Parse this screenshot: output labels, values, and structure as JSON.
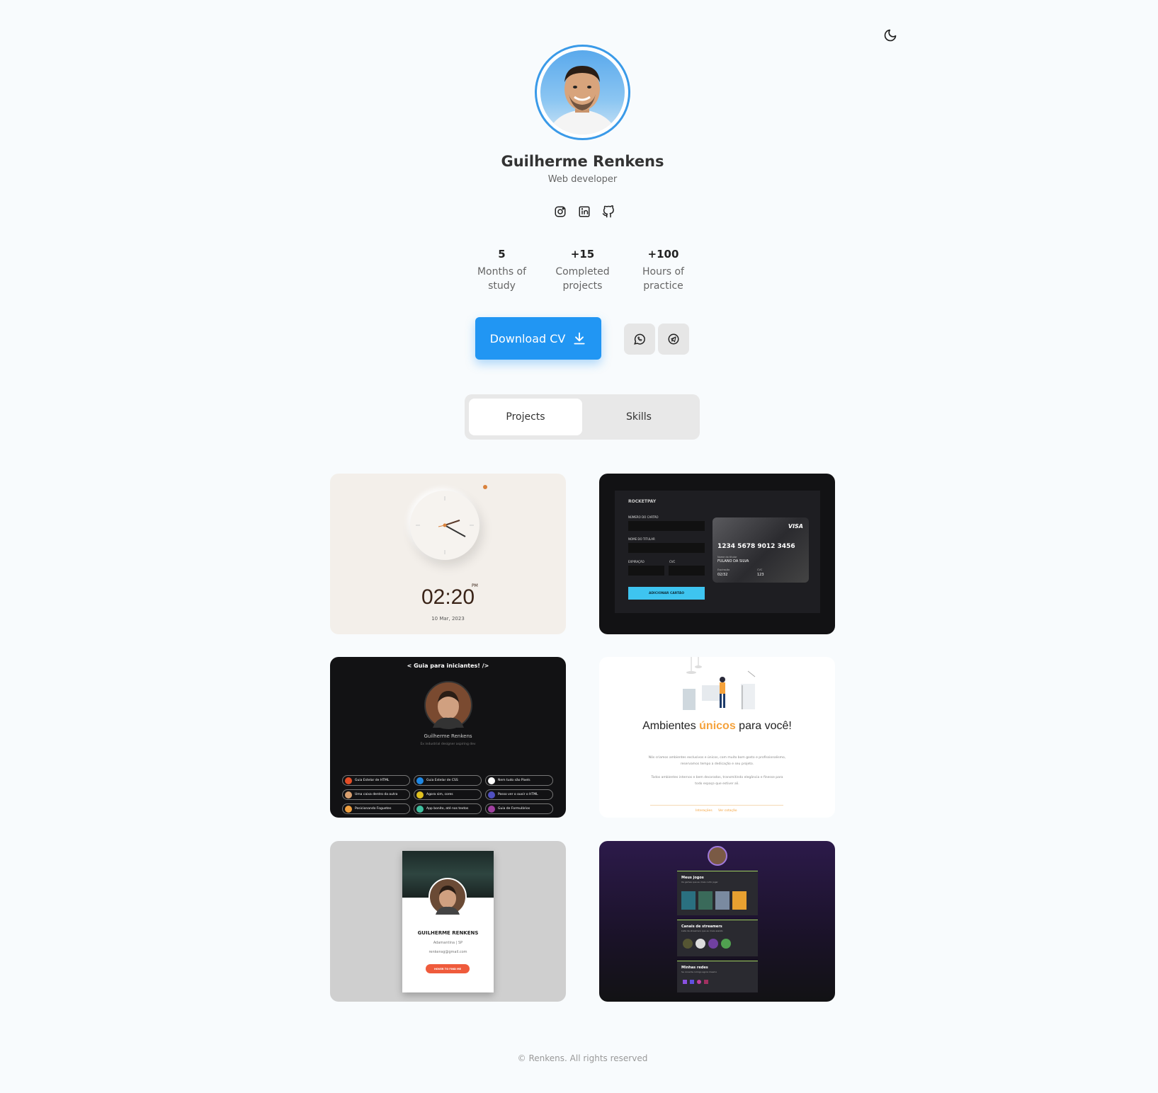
{
  "profile": {
    "name": "Guilherme Renkens",
    "role": "Web developer"
  },
  "socials": [
    {
      "icon": "instagram-icon"
    },
    {
      "icon": "linkedin-icon"
    },
    {
      "icon": "github-icon"
    }
  ],
  "stats": [
    {
      "num": "5",
      "label": "Months of study"
    },
    {
      "num": "+15",
      "label": "Completed projects"
    },
    {
      "num": "+100",
      "label": "Hours of practice"
    }
  ],
  "actions": {
    "download_cv": "Download CV",
    "whatsapp_icon": "whatsapp-icon",
    "telegram_icon": "telegram-icon"
  },
  "tabs": [
    {
      "label": "Projects",
      "active": true
    },
    {
      "label": "Skills",
      "active": false
    }
  ],
  "projects": {
    "clock": {
      "time": "02:20",
      "ampm": "PM",
      "date": "10 Mar, 2023"
    },
    "rocketpay": {
      "brand": "ROCKETPAY",
      "card_number_label": "NÚMERO DO CARTÃO",
      "holder_label": "NOME DO TITULAR",
      "expiry_label": "EXPIRAÇÃO",
      "cvc_label": "CVC",
      "button": "ADICIONAR CARTÃO",
      "card_brand": "VISA",
      "card_number": "1234 5678 9012 3456",
      "card_holder_caption": "Nome do titular",
      "card_holder": "FULANO DA SILVA",
      "card_expiry_caption": "Expiração",
      "card_expiry": "02/32",
      "card_cvc_caption": "CVC",
      "card_cvc": "123"
    },
    "guide": {
      "title": "< Guia para iniciantes! />",
      "name": "Guilherme Renkens",
      "subtitle": "Ex industrial designer aspiring dev",
      "links": [
        "Guia Estelar de HTML",
        "Guia Estelar de CSS",
        "Nem tudo são Pixels",
        "Uma caixa dentro da outra",
        "Agora sim, cores",
        "Posso ver o ouvir o HTML",
        "Posicionando Foguetes",
        "App bonito, até nos textos",
        "Guia de Formulários"
      ]
    },
    "ambientes": {
      "title_a": "Ambientes ",
      "title_b": "únicos",
      "title_c": " para você!",
      "body1": "Nós criamos ambientes exclusivos e únicos, com muito bom gosto e profissionalismo, reservamos tempo a dedicação e seu projeto.",
      "body2": "Todos ambientes internos e bem decorados, transmitindo elegância e finesse para todo espaço que estiver ali.",
      "link1": "Interações",
      "link2": "Ver cotação"
    },
    "profile_card": {
      "name": "GUILHERME RENKENS",
      "location": "Adamantina | SP",
      "email": "renkensg@gmail.com",
      "button": "HOVER TO FIND ME"
    },
    "gamer": {
      "section1": "Meus jogos",
      "section1_sub": "Os games que eu mais curto jogar",
      "section2": "Canais de streamers",
      "section2_sub": "Lista de streamers que eu mais assisto",
      "section3": "Minhas redes",
      "section3_sub": "Se conecte comigo agora mesmo"
    }
  },
  "footer": "© Renkens. All rights reserved",
  "colors": {
    "accent": "#2196f3",
    "avatar_ring": "#3a9ae8",
    "orange": "#f5a23b",
    "cyan": "#3ec4f0"
  }
}
